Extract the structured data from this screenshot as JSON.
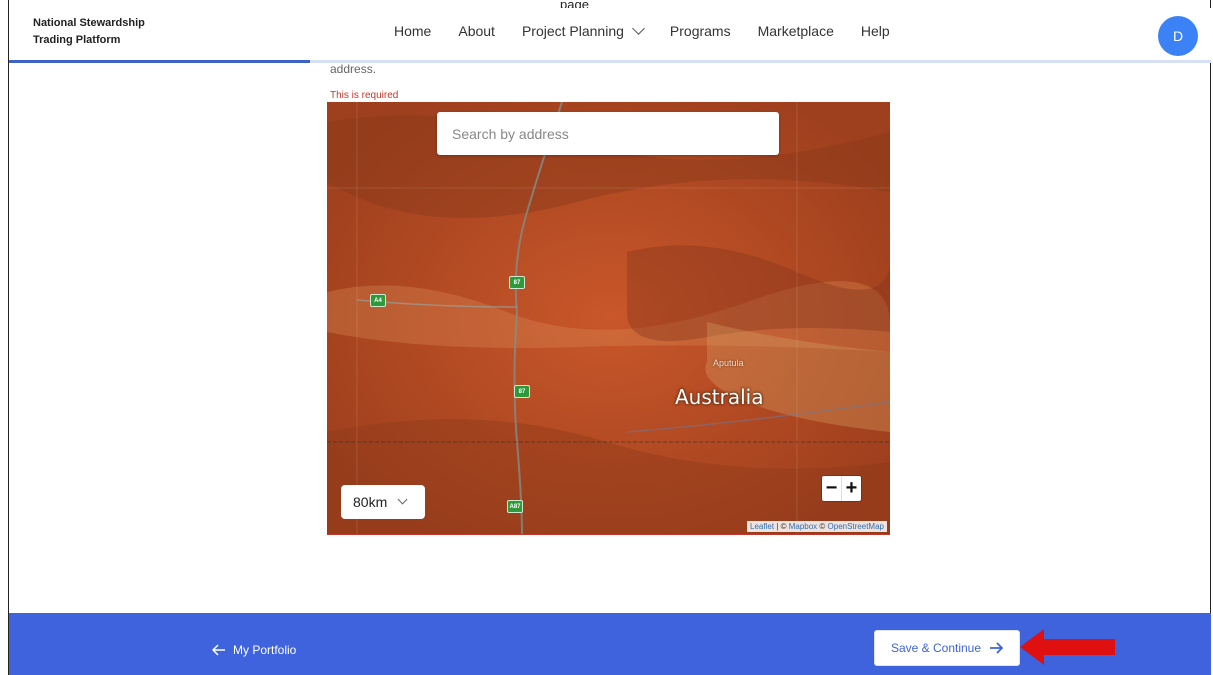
{
  "caption": "page",
  "brand": {
    "line1": "National Stewardship",
    "line2": "Trading Platform"
  },
  "nav": [
    {
      "label": "Home"
    },
    {
      "label": "About"
    },
    {
      "label": "Project Planning"
    },
    {
      "label": "Programs"
    },
    {
      "label": "Marketplace"
    },
    {
      "label": "Help"
    }
  ],
  "user": {
    "initial": "D"
  },
  "progress": {
    "fraction": 0.25
  },
  "form": {
    "helper_text": "address.",
    "error_text": "This is required"
  },
  "map": {
    "search_placeholder": "Search by address",
    "scale_value": "80km",
    "zoom_out": "−",
    "zoom_in": "+",
    "country_label": "Australia",
    "town_label": "Aputula",
    "road_labels": [
      "87",
      "A4",
      "87",
      "A87"
    ],
    "attribution": {
      "leaflet": "Leaflet",
      "sep": " | © ",
      "mapbox": "Mapbox",
      "sep2": " © ",
      "osm": "OpenStreetMap"
    }
  },
  "footer": {
    "back_label": "My Portfolio",
    "save_label": "Save & Continue"
  },
  "colors": {
    "accent": "#3e63dd",
    "error": "#c0392b",
    "annotation_arrow": "#e01010"
  }
}
